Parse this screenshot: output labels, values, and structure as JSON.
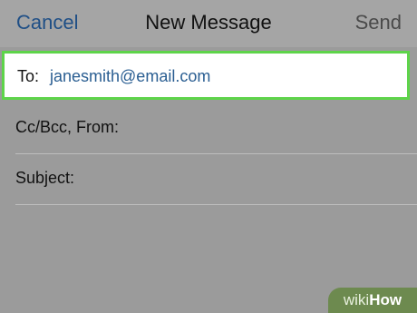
{
  "nav": {
    "cancel_label": "Cancel",
    "title": "New Message",
    "send_label": "Send"
  },
  "to_field": {
    "label": "To:",
    "value": "janesmith@email.com"
  },
  "cc_field": {
    "label": "Cc/Bcc, From:"
  },
  "subject_field": {
    "label": "Subject:"
  },
  "watermark": {
    "wiki": "wiki",
    "how": "How"
  },
  "colors": {
    "highlight": "#5ed44a",
    "accent": "#1f4f86"
  }
}
